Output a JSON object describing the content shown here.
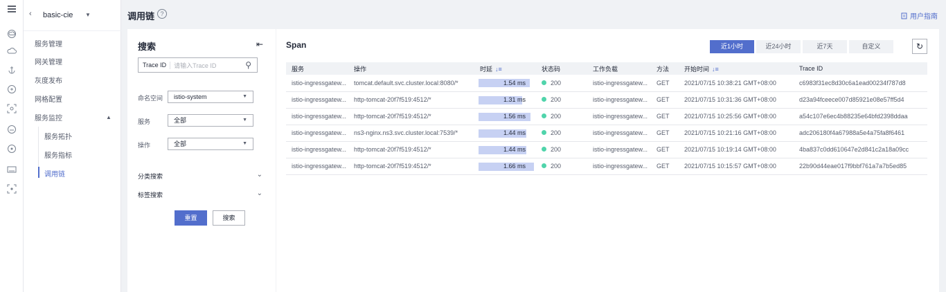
{
  "rail": {
    "icons": [
      "menu-icon",
      "cloud-icon",
      "cloud-upload-icon",
      "anchor-icon",
      "target-icon",
      "scan-icon",
      "cloud-server-icon",
      "compass-icon",
      "keyboard-icon",
      "scan-alt-icon"
    ]
  },
  "sidebar": {
    "project": "basic-cie",
    "items": [
      {
        "label": "服务管理"
      },
      {
        "label": "网关管理"
      },
      {
        "label": "灰度发布"
      },
      {
        "label": "网格配置"
      },
      {
        "label": "服务监控"
      }
    ],
    "sub_items": [
      {
        "label": "服务拓扑"
      },
      {
        "label": "服务指标"
      },
      {
        "label": "调用链"
      }
    ]
  },
  "header": {
    "title": "调用链",
    "help": "?",
    "guide": "用户指南"
  },
  "search": {
    "title": "搜索",
    "trace_label": "Trace ID",
    "trace_placeholder": "请输入Trace ID",
    "namespace_label": "命名空间",
    "namespace_value": "istio-system",
    "service_label": "服务",
    "service_value": "全部",
    "operation_label": "操作",
    "operation_value": "全部",
    "category_search": "分类搜索",
    "tag_search": "标签搜索",
    "reset_label": "重置",
    "search_label": "搜索"
  },
  "main": {
    "title": "Span",
    "ranges": [
      {
        "label": "近1小时",
        "active": true
      },
      {
        "label": "近24小时",
        "active": false
      },
      {
        "label": "近7天",
        "active": false
      },
      {
        "label": "自定义",
        "active": false
      }
    ],
    "columns": [
      "服务",
      "操作",
      "时延",
      "状态码",
      "工作负载",
      "方法",
      "开始时间",
      "Trace ID"
    ],
    "rows": [
      {
        "service": "istio-ingressgatew...",
        "operation": "tomcat.default.svc.cluster.local:8080/*",
        "latency": "1.54 ms",
        "latency_ms": 1.54,
        "status": "200",
        "workload": "istio-ingressgatew...",
        "method": "GET",
        "start": "2021/07/15 10:38:21 GMT+08:00",
        "trace_id": "c6983f31ec8d30c6a1ead00234f787d8"
      },
      {
        "service": "istio-ingressgatew...",
        "operation": "http-tomcat-20f7f519:4512/*",
        "latency": "1.31 ms",
        "latency_ms": 1.31,
        "status": "200",
        "workload": "istio-ingressgatew...",
        "method": "GET",
        "start": "2021/07/15 10:31:36 GMT+08:00",
        "trace_id": "d23a94fceece007d85921e08e57ff5d4"
      },
      {
        "service": "istio-ingressgatew...",
        "operation": "http-tomcat-20f7f519:4512/*",
        "latency": "1.56 ms",
        "latency_ms": 1.56,
        "status": "200",
        "workload": "istio-ingressgatew...",
        "method": "GET",
        "start": "2021/07/15 10:25:56 GMT+08:00",
        "trace_id": "a54c107e6ec4b88235e64bfd2398ddaa"
      },
      {
        "service": "istio-ingressgatew...",
        "operation": "ns3-nginx.ns3.svc.cluster.local:7539/*",
        "latency": "1.44 ms",
        "latency_ms": 1.44,
        "status": "200",
        "workload": "istio-ingressgatew...",
        "method": "GET",
        "start": "2021/07/15 10:21:16 GMT+08:00",
        "trace_id": "adc206180f4a67988a5e4a75fa8f6461"
      },
      {
        "service": "istio-ingressgatew...",
        "operation": "http-tomcat-20f7f519:4512/*",
        "latency": "1.44 ms",
        "latency_ms": 1.44,
        "status": "200",
        "workload": "istio-ingressgatew...",
        "method": "GET",
        "start": "2021/07/15 10:19:14 GMT+08:00",
        "trace_id": "4ba837c0dd610647e2d841c2a18a09cc"
      },
      {
        "service": "istio-ingressgatew...",
        "operation": "http-tomcat-20f7f519:4512/*",
        "latency": "1.66 ms",
        "latency_ms": 1.66,
        "status": "200",
        "workload": "istio-ingressgatew...",
        "method": "GET",
        "start": "2021/07/15 10:15:57 GMT+08:00",
        "trace_id": "22b90d44eae017f9bbf761a7a7b5ed85"
      }
    ]
  },
  "colors": {
    "accent": "#526ecc",
    "status_ok": "#50d4ab",
    "latency_bar": "#c7d1f3"
  }
}
